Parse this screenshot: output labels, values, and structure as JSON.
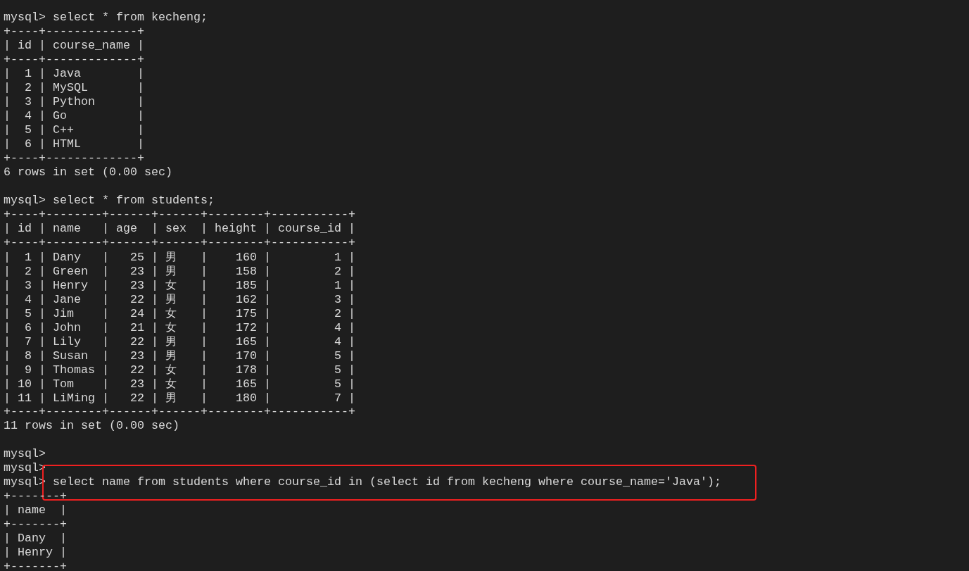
{
  "terminal": {
    "lines": [
      {
        "kind": "text",
        "text": "mysql> select * from kecheng;",
        "highlighted": false
      },
      {
        "kind": "text",
        "text": "+----+-------------+",
        "highlighted": false
      },
      {
        "kind": "text",
        "text": "| id | course_name |",
        "highlighted": false
      },
      {
        "kind": "text",
        "text": "+----+-------------+",
        "highlighted": false
      },
      {
        "kind": "text",
        "text": "|  1 | Java        |",
        "highlighted": false
      },
      {
        "kind": "text",
        "text": "|  2 | MySQL       |",
        "highlighted": false
      },
      {
        "kind": "text",
        "text": "|  3 | Python      |",
        "highlighted": false
      },
      {
        "kind": "text",
        "text": "|  4 | Go          |",
        "highlighted": false
      },
      {
        "kind": "text",
        "text": "|  5 | C++         |",
        "highlighted": false
      },
      {
        "kind": "text",
        "text": "|  6 | HTML        |",
        "highlighted": false
      },
      {
        "kind": "text",
        "text": "+----+-------------+",
        "highlighted": false
      },
      {
        "kind": "text",
        "text": "6 rows in set (0.00 sec)",
        "highlighted": false
      },
      {
        "kind": "blank"
      },
      {
        "kind": "text",
        "text": "mysql> select * from students;",
        "highlighted": false
      },
      {
        "kind": "text",
        "text": "+----+--------+------+------+--------+-----------+",
        "highlighted": false
      },
      {
        "kind": "text",
        "text": "| id | name   | age  | sex  | height | course_id |",
        "highlighted": false
      },
      {
        "kind": "text",
        "text": "+----+--------+------+------+--------+-----------+",
        "highlighted": false
      },
      {
        "kind": "text",
        "text": "|  1 | Dany   |   25 | 男   |    160 |         1 |",
        "highlighted": false
      },
      {
        "kind": "text",
        "text": "|  2 | Green  |   23 | 男   |    158 |         2 |",
        "highlighted": false
      },
      {
        "kind": "text",
        "text": "|  3 | Henry  |   23 | 女   |    185 |         1 |",
        "highlighted": false
      },
      {
        "kind": "text",
        "text": "|  4 | Jane   |   22 | 男   |    162 |         3 |",
        "highlighted": false
      },
      {
        "kind": "text",
        "text": "|  5 | Jim    |   24 | 女   |    175 |         2 |",
        "highlighted": false
      },
      {
        "kind": "text",
        "text": "|  6 | John   |   21 | 女   |    172 |         4 |",
        "highlighted": false
      },
      {
        "kind": "text",
        "text": "|  7 | Lily   |   22 | 男   |    165 |         4 |",
        "highlighted": false
      },
      {
        "kind": "text",
        "text": "|  8 | Susan  |   23 | 男   |    170 |         5 |",
        "highlighted": false
      },
      {
        "kind": "text",
        "text": "|  9 | Thomas |   22 | 女   |    178 |         5 |",
        "highlighted": false
      },
      {
        "kind": "text",
        "text": "| 10 | Tom    |   23 | 女   |    165 |         5 |",
        "highlighted": false
      },
      {
        "kind": "text",
        "text": "| 11 | LiMing |   22 | 男   |    180 |         7 |",
        "highlighted": false
      },
      {
        "kind": "text",
        "text": "+----+--------+------+------+--------+-----------+",
        "highlighted": false
      },
      {
        "kind": "text",
        "text": "11 rows in set (0.00 sec)",
        "highlighted": false
      },
      {
        "kind": "blank"
      },
      {
        "kind": "text",
        "text": "mysql>",
        "highlighted": false
      },
      {
        "kind": "text",
        "text": "mysql>",
        "highlighted": false
      },
      {
        "kind": "text",
        "text": "mysql> select name from students where course_id in (select id from kecheng where course_name='Java');",
        "highlighted": true
      },
      {
        "kind": "text",
        "text": "+-------+",
        "highlighted": false
      },
      {
        "kind": "text",
        "text": "| name  |",
        "highlighted": false
      },
      {
        "kind": "text",
        "text": "+-------+",
        "highlighted": false
      },
      {
        "kind": "text",
        "text": "| Dany  |",
        "highlighted": false
      },
      {
        "kind": "text",
        "text": "| Henry |",
        "highlighted": false
      },
      {
        "kind": "text",
        "text": "+-------+",
        "highlighted": false
      }
    ]
  }
}
